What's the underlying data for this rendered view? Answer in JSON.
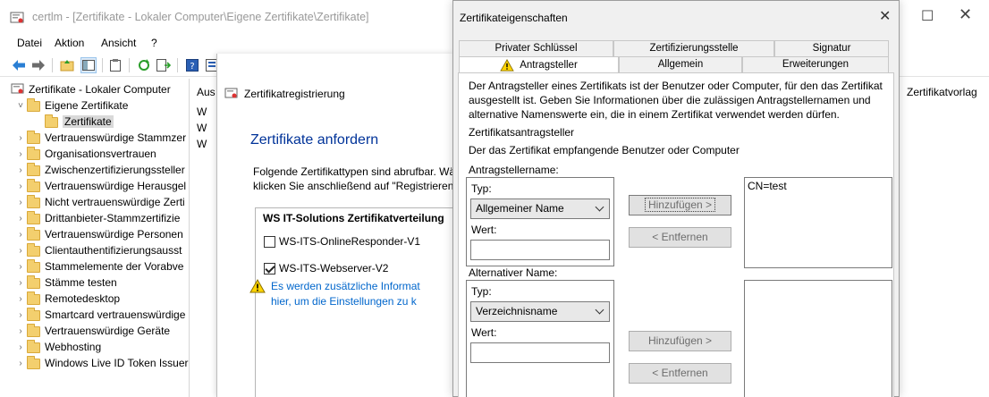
{
  "mmc": {
    "title": "certlm - [Zertifikate - Lokaler Computer\\Eigene Zertifikate\\Zertifikate]",
    "menu": [
      "Datei",
      "Aktion",
      "Ansicht",
      "?"
    ],
    "tree": [
      {
        "label": "Zertifikate - Lokaler Computer",
        "level": 0,
        "twisty": ""
      },
      {
        "label": "Eigene Zertifikate",
        "level": 1,
        "twisty": "˅"
      },
      {
        "label": "Zertifikate",
        "level": 2,
        "twisty": "",
        "selected": true
      },
      {
        "label": "Vertrauenswürdige Stammzer",
        "level": 1,
        "twisty": "›"
      },
      {
        "label": "Organisationsvertrauen",
        "level": 1,
        "twisty": "›"
      },
      {
        "label": "Zwischenzertifizierungssteller",
        "level": 1,
        "twisty": "›"
      },
      {
        "label": "Vertrauenswürdige Herausgel",
        "level": 1,
        "twisty": "›"
      },
      {
        "label": "Nicht vertrauenswürdige Zerti",
        "level": 1,
        "twisty": "›"
      },
      {
        "label": "Drittanbieter-Stammzertifizie",
        "level": 1,
        "twisty": "›"
      },
      {
        "label": "Vertrauenswürdige Personen",
        "level": 1,
        "twisty": "›"
      },
      {
        "label": "Clientauthentifizierungsausst",
        "level": 1,
        "twisty": "›"
      },
      {
        "label": "Stammelemente der Vorabve",
        "level": 1,
        "twisty": "›"
      },
      {
        "label": "Stämme testen",
        "level": 1,
        "twisty": "›"
      },
      {
        "label": "Remotedesktop",
        "level": 1,
        "twisty": "›"
      },
      {
        "label": "Smartcard vertrauenswürdige",
        "level": 1,
        "twisty": "›"
      },
      {
        "label": "Vertrauenswürdige Geräte",
        "level": 1,
        "twisty": "›"
      },
      {
        "label": "Webhosting",
        "level": 1,
        "twisty": "›"
      },
      {
        "label": "Windows Live ID Token Issuer",
        "level": 1,
        "twisty": "›"
      }
    ],
    "middle_header": "Aus",
    "middle_rows": [
      "W",
      "W",
      "W"
    ],
    "right_column_header": "Zertifikatvorlag"
  },
  "wizard": {
    "title": "Zertifikatregistrierung",
    "heading": "Zertifikate anfordern",
    "desc_line1": "Folgende Zertifikattypen sind abrufbar. Wä",
    "desc_line2": "klicken Sie anschließend auf \"Registrieren\"",
    "box_title": "WS IT-Solutions Zertifikatverteilung",
    "templates": [
      {
        "label": "WS-ITS-OnlineResponder-V1",
        "checked": false
      },
      {
        "label": "WS-ITS-Webserver-V2",
        "checked": true
      }
    ],
    "warning_line1": "Es werden zusätzliche Informat",
    "warning_line2": "hier, um die Einstellungen zu k"
  },
  "dialog": {
    "title": "Zertifikateigenschaften",
    "tabs_top": [
      "Privater Schlüssel",
      "Zertifizierungsstelle",
      "Signatur"
    ],
    "tabs_bottom": [
      "Antragsteller",
      "Allgemein",
      "Erweiterungen"
    ],
    "active_tab": "Antragsteller",
    "intro_line1": "Der Antragsteller eines Zertifikats ist der Benutzer oder Computer, für den das Zertifikat",
    "intro_line2": "ausgestellt ist. Geben Sie Informationen über die zulässigen Antragstellernamen und",
    "intro_line3": "alternative Namenswerte ein, die in einem Zertifikat verwendet werden dürfen.",
    "section_heading": "Zertifikatsantragsteller",
    "section_desc": "Der das Zertifikat empfangende Benutzer oder Computer",
    "subject": {
      "label": "Antragstellername:",
      "type_label": "Typ:",
      "type_value": "Allgemeiner Name",
      "value_label": "Wert:",
      "value": "",
      "add_label": "Hinzufügen >",
      "remove_label": "< Entfernen",
      "list": [
        "CN=test"
      ]
    },
    "alt": {
      "label": "Alternativer Name:",
      "type_label": "Typ:",
      "type_value": "Verzeichnisname",
      "value_label": "Wert:",
      "value": "",
      "add_label": "Hinzufügen >",
      "remove_label": "< Entfernen",
      "list": []
    }
  }
}
